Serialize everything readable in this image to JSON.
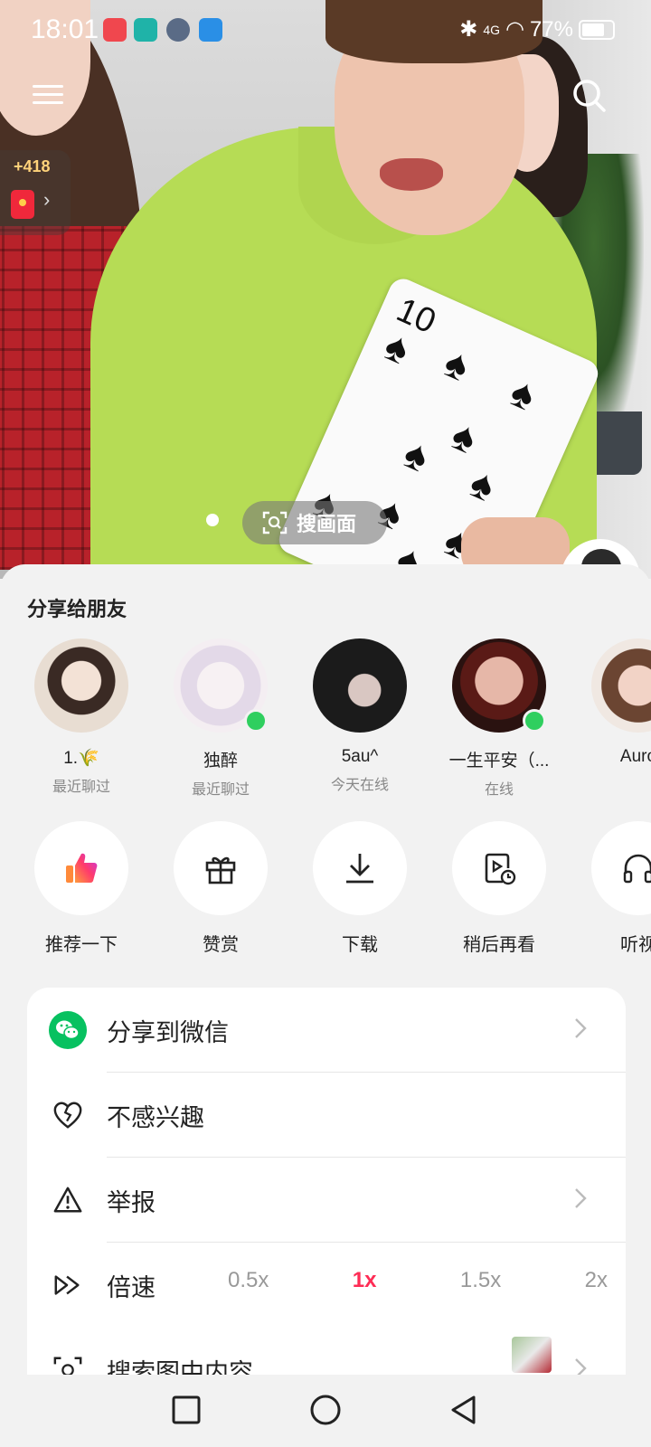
{
  "status_bar": {
    "time": "18:01",
    "battery": "77%",
    "network": "4G"
  },
  "overlay": {
    "reward_count": "+418",
    "search_frame_label": "搜画面"
  },
  "share_sheet": {
    "title": "分享给朋友",
    "friends": [
      {
        "name": "1.🌾",
        "sub": "最近聊过",
        "online": false
      },
      {
        "name": "独醉",
        "sub": "最近聊过",
        "online": true
      },
      {
        "name": "5au^",
        "sub": "今天在线",
        "online": false
      },
      {
        "name": "一生平安（...",
        "sub": "在线",
        "online": true
      },
      {
        "name": "Auro",
        "sub": "",
        "online": false
      }
    ],
    "actions": [
      {
        "label": "推荐一下",
        "icon": "thumbs-up-icon"
      },
      {
        "label": "赞赏",
        "icon": "gift-icon"
      },
      {
        "label": "下载",
        "icon": "download-icon"
      },
      {
        "label": "稍后再看",
        "icon": "watch-later-icon"
      },
      {
        "label": "听视",
        "icon": "headphones-icon"
      }
    ],
    "menu": {
      "wechat": "分享到微信",
      "not_interested": "不感兴趣",
      "report": "举报",
      "speed": "倍速",
      "speed_options": [
        "0.5x",
        "1x",
        "1.5x",
        "2x"
      ],
      "speed_selected": "1x",
      "search_in_image": "搜索图中内容"
    }
  },
  "colors": {
    "accent": "#fe2c55",
    "wechat": "#07c160",
    "online": "#2fcf5f"
  }
}
